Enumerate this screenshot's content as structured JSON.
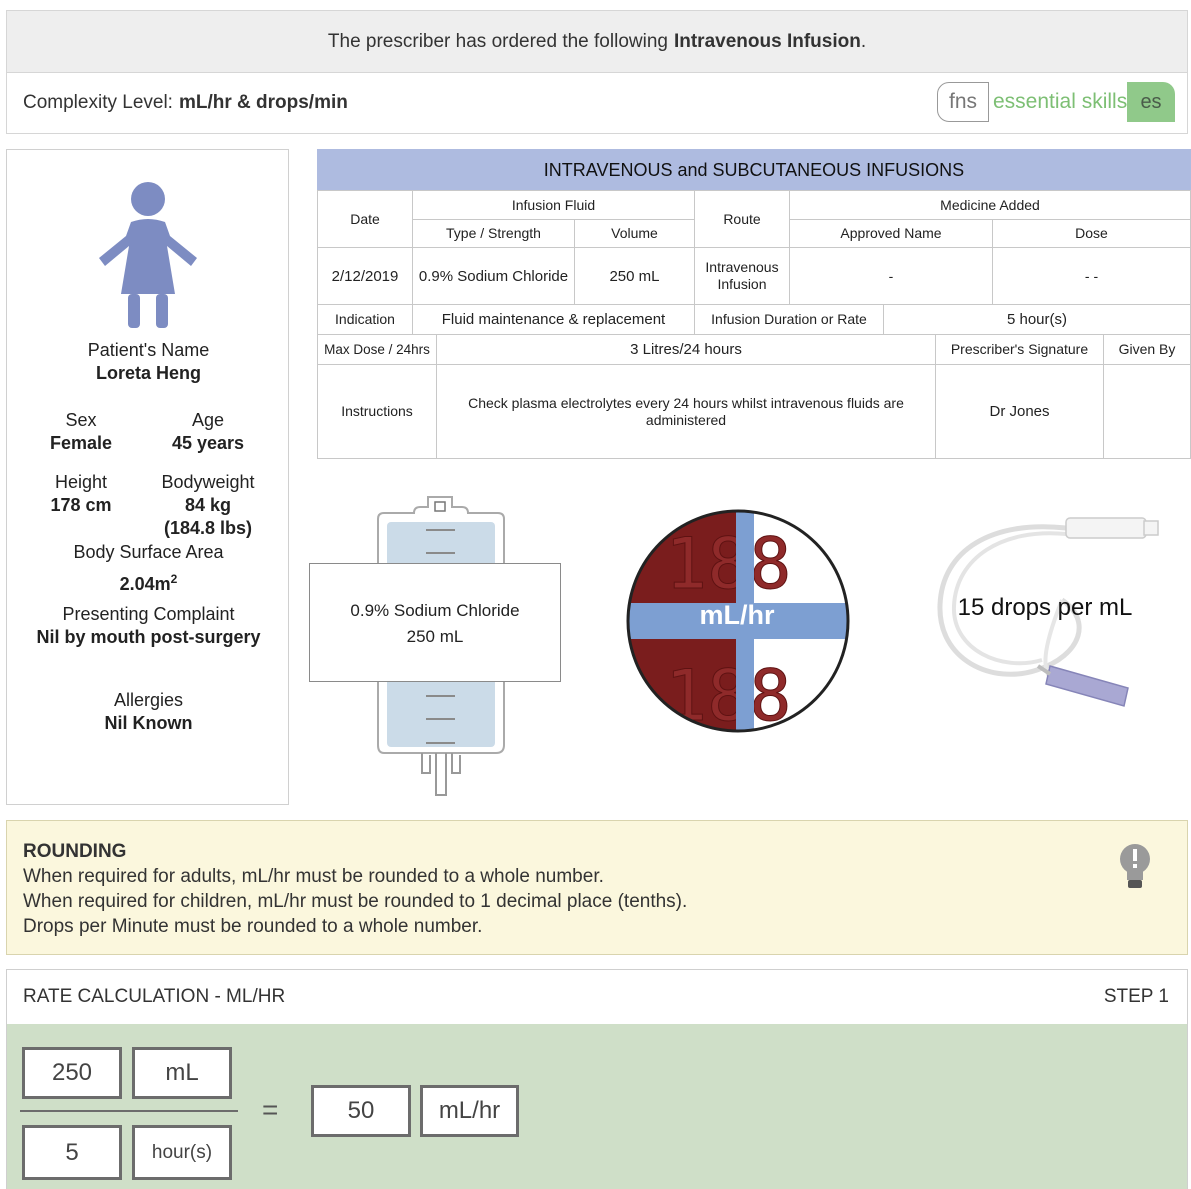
{
  "header": {
    "order_text": "The prescriber has ordered the following",
    "order_bold": "Intravenous Infusion",
    "order_end": ".",
    "complexity_label": "Complexity Level:",
    "complexity_value": "mL/hr & drops/min"
  },
  "logo": {
    "fns": "fns",
    "word": "essential skills",
    "es": "es"
  },
  "patient": {
    "name_label": "Patient's Name",
    "name": "Loreta Heng",
    "sex_label": "Sex",
    "sex": "Female",
    "age_label": "Age",
    "age": "45 years",
    "height_label": "Height",
    "height": "178 cm",
    "weight_label": "Bodyweight",
    "weight": "84 kg",
    "weight_lbs": "(184.8 lbs)",
    "bsa_label": "Body Surface Area",
    "bsa": "2.04m",
    "bsa_sup": "2",
    "complaint_label": "Presenting Complaint",
    "complaint": "Nil by mouth post-surgery",
    "allergies_label": "Allergies",
    "allergies": "Nil Known"
  },
  "chart": {
    "title": "INTRAVENOUS and SUBCUTANEOUS INFUSIONS",
    "headers": {
      "date": "Date",
      "infusion_fluid": "Infusion Fluid",
      "type_strength": "Type / Strength",
      "volume": "Volume",
      "route": "Route",
      "medicine_added": "Medicine Added",
      "approved_name": "Approved Name",
      "dose": "Dose",
      "indication": "Indication",
      "duration_rate": "Infusion Duration or Rate",
      "max_dose": "Max Dose / 24hrs",
      "prescriber_signature": "Prescriber's Signature",
      "given_by": "Given By",
      "instructions": "Instructions"
    },
    "row": {
      "date": "2/12/2019",
      "type_strength": "0.9% Sodium Chloride",
      "volume": "250 mL",
      "route": "Intravenous Infusion",
      "approved_name": "-",
      "dose": "- -",
      "indication": "Fluid maintenance & replacement",
      "duration_rate": "5 hour(s)",
      "max_dose": "3 Litres/24 hours",
      "instructions": "Check plasma electrolytes every 24 hours whilst intravenous fluids are administered",
      "prescriber_signature": "Dr Jones",
      "given_by": ""
    }
  },
  "illustrations": {
    "bag_line1": "0.9% Sodium Chloride",
    "bag_line2": "250 mL",
    "pump_label": "mL/hr",
    "pump_digits": "188",
    "drop_factor": "15 drops per mL"
  },
  "rounding": {
    "title": "ROUNDING",
    "lines": [
      "When required for adults, mL/hr must be rounded to a whole number.",
      "When required for children, mL/hr must be rounded to 1 decimal place (tenths).",
      "Drops per Minute must be rounded to a whole number."
    ]
  },
  "step": {
    "title": "RATE CALCULATION - ML/HR",
    "step_label": "STEP 1",
    "numerator_value": "250",
    "numerator_unit": "mL",
    "denominator_value": "5",
    "denominator_unit": "hour(s)",
    "equals": "=",
    "result_value": "50",
    "result_unit": "mL/hr"
  },
  "colors": {
    "chart_header": "#aebbe0",
    "patient_figure": "#7d8cc2",
    "pump_red": "#7a1d1d",
    "pump_blue": "#7d9fd2",
    "rounding_bg": "#fbf7dd",
    "step_bg": "#cfdfc8",
    "logo_green": "#7dbf74"
  }
}
